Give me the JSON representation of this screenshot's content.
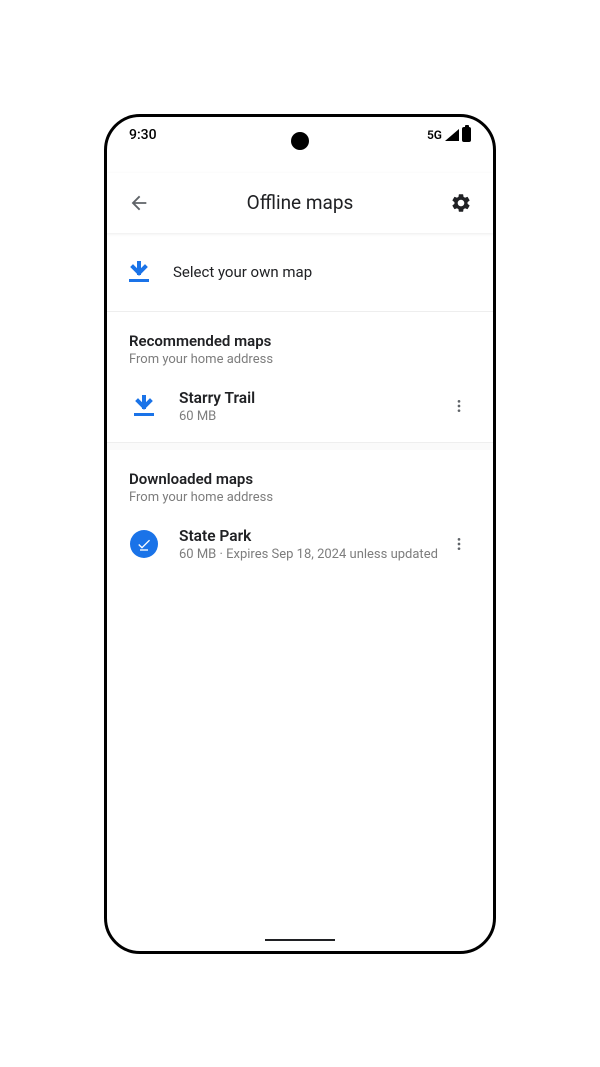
{
  "status": {
    "time": "9:30",
    "network": "5G"
  },
  "header": {
    "title": "Offline maps"
  },
  "select_own": {
    "label": "Select your own map"
  },
  "recommended": {
    "title": "Recommended maps",
    "subtitle": "From your home address",
    "items": [
      {
        "name": "Starry Trail",
        "meta": "60 MB"
      }
    ]
  },
  "downloaded": {
    "title": "Downloaded maps",
    "subtitle": "From your home address",
    "items": [
      {
        "name": "State Park",
        "meta": "60  MB · Expires Sep 18, 2024 unless updated"
      }
    ]
  },
  "colors": {
    "accent": "#1a73e8"
  }
}
